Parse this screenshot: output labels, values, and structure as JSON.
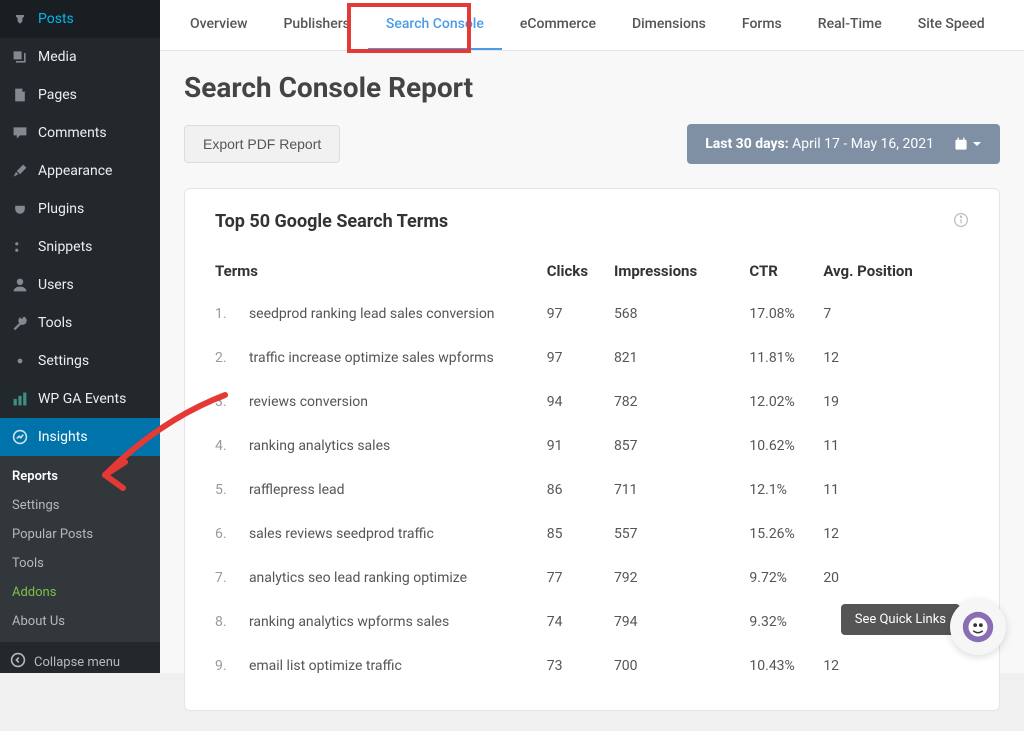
{
  "sidebar": {
    "items": [
      {
        "label": "Posts",
        "icon": "pin"
      },
      {
        "label": "Media",
        "icon": "media"
      },
      {
        "label": "Pages",
        "icon": "page"
      },
      {
        "label": "Comments",
        "icon": "comment"
      },
      {
        "label": "Appearance",
        "icon": "brush"
      },
      {
        "label": "Plugins",
        "icon": "plug"
      },
      {
        "label": "Snippets",
        "icon": "scissors"
      },
      {
        "label": "Users",
        "icon": "user"
      },
      {
        "label": "Tools",
        "icon": "wrench"
      },
      {
        "label": "Settings",
        "icon": "gear"
      },
      {
        "label": "WP GA Events",
        "icon": "ga"
      },
      {
        "label": "Insights",
        "icon": "insights",
        "active": true
      }
    ],
    "submenu": [
      {
        "label": "Reports",
        "current": true
      },
      {
        "label": "Settings"
      },
      {
        "label": "Popular Posts"
      },
      {
        "label": "Tools"
      },
      {
        "label": "Addons",
        "addons": true
      },
      {
        "label": "About Us"
      }
    ],
    "collapse_label": "Collapse menu"
  },
  "tabs": [
    {
      "label": "Overview"
    },
    {
      "label": "Publishers"
    },
    {
      "label": "Search Console",
      "active": true
    },
    {
      "label": "eCommerce"
    },
    {
      "label": "Dimensions"
    },
    {
      "label": "Forms"
    },
    {
      "label": "Real-Time"
    },
    {
      "label": "Site Speed"
    }
  ],
  "page_title": "Search Console Report",
  "export_label": "Export PDF Report",
  "date_range": {
    "prefix": "Last 30 days:",
    "range": "April 17 - May 16, 2021"
  },
  "table": {
    "title": "Top 50 Google Search Terms",
    "headers": [
      "Terms",
      "Clicks",
      "Impressions",
      "CTR",
      "Avg. Position"
    ],
    "rows": [
      {
        "n": "1.",
        "term": "seedprod ranking lead sales conversion",
        "clicks": "97",
        "impressions": "568",
        "ctr": "17.08%",
        "pos": "7"
      },
      {
        "n": "2.",
        "term": "traffic increase optimize sales wpforms",
        "clicks": "97",
        "impressions": "821",
        "ctr": "11.81%",
        "pos": "12"
      },
      {
        "n": "3.",
        "term": "reviews conversion",
        "clicks": "94",
        "impressions": "782",
        "ctr": "12.02%",
        "pos": "19"
      },
      {
        "n": "4.",
        "term": "ranking analytics sales",
        "clicks": "91",
        "impressions": "857",
        "ctr": "10.62%",
        "pos": "11"
      },
      {
        "n": "5.",
        "term": "rafflepress lead",
        "clicks": "86",
        "impressions": "711",
        "ctr": "12.1%",
        "pos": "11"
      },
      {
        "n": "6.",
        "term": "sales reviews seedprod traffic",
        "clicks": "85",
        "impressions": "557",
        "ctr": "15.26%",
        "pos": "12"
      },
      {
        "n": "7.",
        "term": "analytics seo lead ranking optimize",
        "clicks": "77",
        "impressions": "792",
        "ctr": "9.72%",
        "pos": "20"
      },
      {
        "n": "8.",
        "term": "ranking analytics wpforms sales",
        "clicks": "74",
        "impressions": "794",
        "ctr": "9.32%",
        "pos": ""
      },
      {
        "n": "9.",
        "term": "email list optimize traffic",
        "clicks": "73",
        "impressions": "700",
        "ctr": "10.43%",
        "pos": "12"
      }
    ]
  },
  "quick_links_label": "See Quick Links"
}
